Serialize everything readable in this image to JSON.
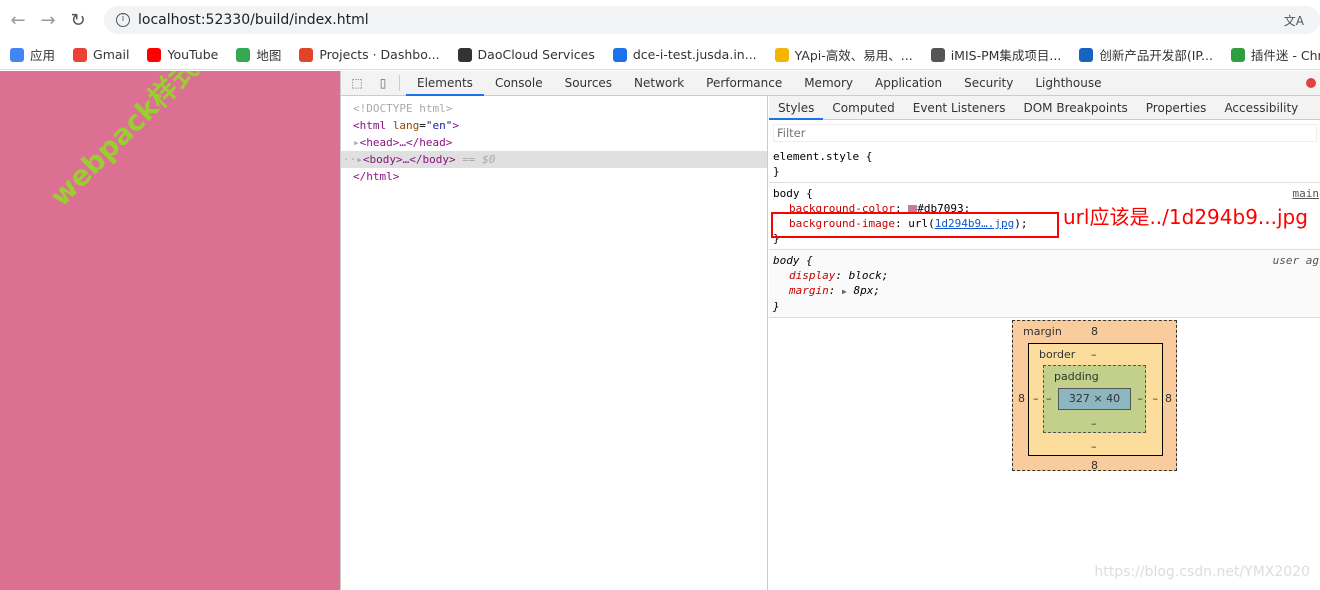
{
  "browser": {
    "url": "localhost:52330/build/index.html"
  },
  "bookmarks": [
    {
      "label": "应用",
      "color": "#4285f4"
    },
    {
      "label": "Gmail",
      "color": "#ea4335"
    },
    {
      "label": "YouTube",
      "color": "#ff0000"
    },
    {
      "label": "地图",
      "color": "#34a853"
    },
    {
      "label": "Projects · Dashbo...",
      "color": "#e24329"
    },
    {
      "label": "DaoCloud Services",
      "color": "#333333"
    },
    {
      "label": "dce-i-test.jusda.in...",
      "color": "#1a73e8"
    },
    {
      "label": "YApi-高效、易用、...",
      "color": "#f4b400"
    },
    {
      "label": "iMIS-PM集成项目...",
      "color": "#555555"
    },
    {
      "label": "创新产品开发部(IP...",
      "color": "#1565c0"
    },
    {
      "label": "插件迷 - Chro",
      "color": "#2e9e3e"
    }
  ],
  "page": {
    "watermark": "webpack样式编",
    "background": "#db7093",
    "text_color": "#9acd32"
  },
  "devtools": {
    "tabs": [
      "Elements",
      "Console",
      "Sources",
      "Network",
      "Performance",
      "Memory",
      "Application",
      "Security",
      "Lighthouse"
    ],
    "active_tab": "Elements",
    "dom": {
      "doctype": "<!DOCTYPE html>",
      "html_open": "<html",
      "lang_attr": "lang",
      "lang_val": "\"en\"",
      "head": "<head>…</head>",
      "body": "<body>…</body>",
      "selected_marker": " == $0",
      "html_close": "</html>"
    },
    "styles_tabs": [
      "Styles",
      "Computed",
      "Event Listeners",
      "DOM Breakpoints",
      "Properties",
      "Accessibility"
    ],
    "filter_placeholder": "Filter",
    "rules": {
      "element_style": "element.style {",
      "close": "}",
      "body_selector": "body {",
      "body_source": "main",
      "bg_color_name": "background-color",
      "bg_color_val": "#db7093;",
      "bg_image_name": "background-image",
      "bg_image_pre": "url(",
      "bg_image_link": "1d294b9….jpg",
      "bg_image_post": ");",
      "annotation": "url应该是../1d294b9...jpg",
      "ua_source": "user ag",
      "display_name": "display",
      "display_val": "block;",
      "margin_name": "margin",
      "margin_val": "8px;"
    },
    "box_model": {
      "margin_label": "margin",
      "margin": "8",
      "border_label": "border",
      "border": "–",
      "padding_label": "padding",
      "padding": "–",
      "content": "327 × 40"
    }
  },
  "credit": "https://blog.csdn.net/YMX2020"
}
